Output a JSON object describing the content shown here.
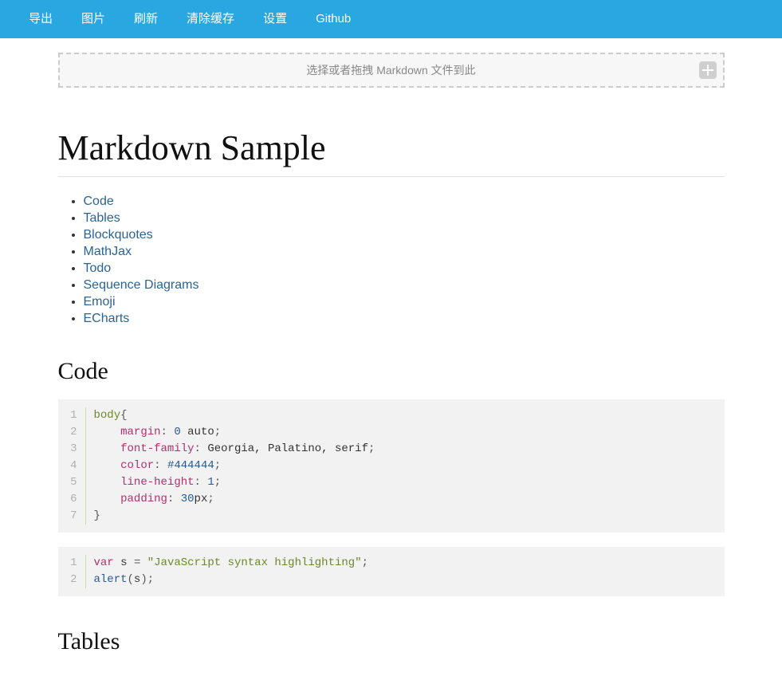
{
  "navbar": {
    "items": [
      {
        "label": "导出"
      },
      {
        "label": "图片"
      },
      {
        "label": "刷新"
      },
      {
        "label": "清除缓存"
      },
      {
        "label": "设置"
      },
      {
        "label": "Github"
      }
    ]
  },
  "dropzone": {
    "text": "选择或者拖拽 Markdown 文件到此"
  },
  "page": {
    "title": "Markdown Sample"
  },
  "toc": [
    "Code",
    "Tables",
    "Blockquotes",
    "MathJax",
    "Todo",
    "Sequence Diagrams",
    "Emoji",
    "ECharts"
  ],
  "sections": {
    "code": {
      "heading": "Code"
    },
    "tables": {
      "heading": "Tables"
    }
  },
  "codeBlocks": {
    "css": {
      "lines": [
        [
          {
            "text": "body",
            "cls": "t-sel"
          },
          {
            "text": "{",
            "cls": "t-punct"
          }
        ],
        [
          {
            "text": "    ",
            "cls": ""
          },
          {
            "text": "margin",
            "cls": "t-prop"
          },
          {
            "text": ": ",
            "cls": "t-punct"
          },
          {
            "text": "0",
            "cls": "t-num"
          },
          {
            "text": " auto",
            "cls": "t-val"
          },
          {
            "text": ";",
            "cls": "t-punct"
          }
        ],
        [
          {
            "text": "    ",
            "cls": ""
          },
          {
            "text": "font-family",
            "cls": "t-prop"
          },
          {
            "text": ": ",
            "cls": "t-punct"
          },
          {
            "text": "Georgia, Palatino, serif",
            "cls": "t-val"
          },
          {
            "text": ";",
            "cls": "t-punct"
          }
        ],
        [
          {
            "text": "    ",
            "cls": ""
          },
          {
            "text": "color",
            "cls": "t-prop"
          },
          {
            "text": ": ",
            "cls": "t-punct"
          },
          {
            "text": "#444444",
            "cls": "t-num"
          },
          {
            "text": ";",
            "cls": "t-punct"
          }
        ],
        [
          {
            "text": "    ",
            "cls": ""
          },
          {
            "text": "line-height",
            "cls": "t-prop"
          },
          {
            "text": ": ",
            "cls": "t-punct"
          },
          {
            "text": "1",
            "cls": "t-num"
          },
          {
            "text": ";",
            "cls": "t-punct"
          }
        ],
        [
          {
            "text": "    ",
            "cls": ""
          },
          {
            "text": "padding",
            "cls": "t-prop"
          },
          {
            "text": ": ",
            "cls": "t-punct"
          },
          {
            "text": "30",
            "cls": "t-num"
          },
          {
            "text": "px",
            "cls": "t-val"
          },
          {
            "text": ";",
            "cls": "t-punct"
          }
        ],
        [
          {
            "text": "}",
            "cls": "t-punct"
          }
        ]
      ]
    },
    "js": {
      "lines": [
        [
          {
            "text": "var",
            "cls": "t-kw"
          },
          {
            "text": " s ",
            "cls": "t-var"
          },
          {
            "text": "=",
            "cls": "t-op"
          },
          {
            "text": " ",
            "cls": ""
          },
          {
            "text": "\"JavaScript syntax highlighting\"",
            "cls": "t-str"
          },
          {
            "text": ";",
            "cls": "t-punct"
          }
        ],
        [
          {
            "text": "alert",
            "cls": "t-func"
          },
          {
            "text": "(",
            "cls": "t-punct"
          },
          {
            "text": "s",
            "cls": "t-var"
          },
          {
            "text": ")",
            "cls": "t-punct"
          },
          {
            "text": ";",
            "cls": "t-punct"
          }
        ]
      ]
    }
  }
}
